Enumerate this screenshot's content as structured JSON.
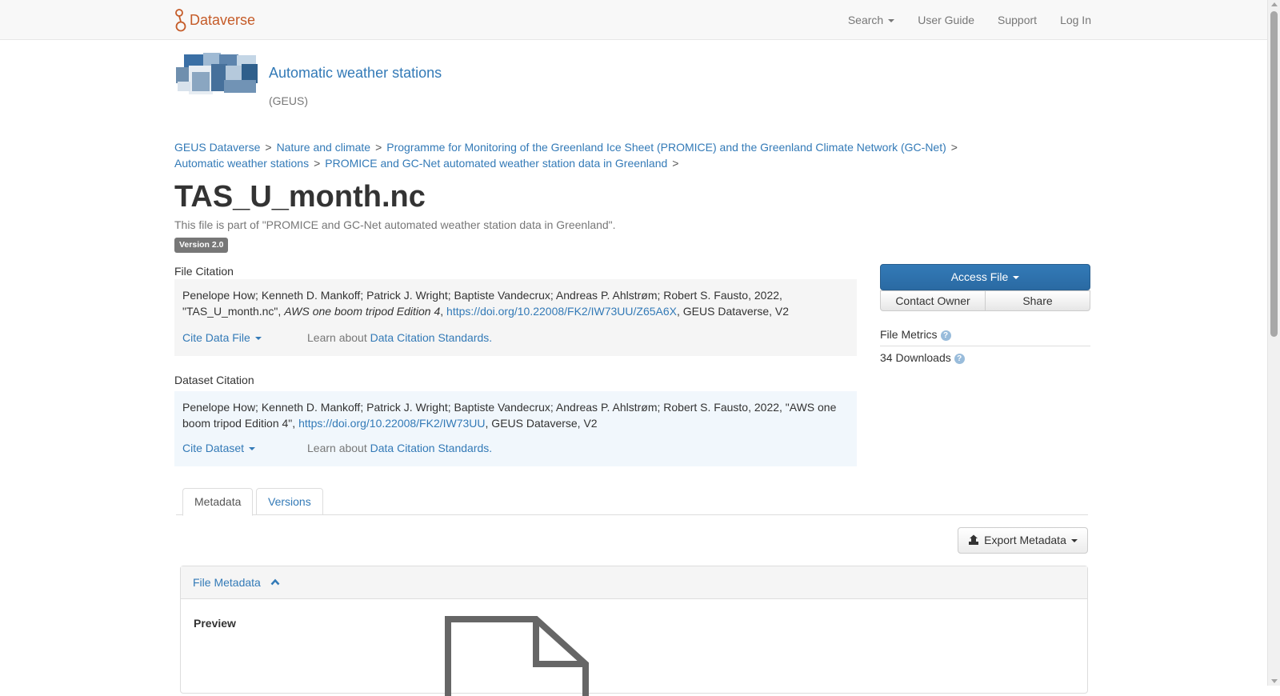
{
  "navbar": {
    "brand": "Dataverse",
    "items": [
      {
        "label": "Search",
        "dropdown": true
      },
      {
        "label": "User Guide"
      },
      {
        "label": "Support"
      },
      {
        "label": "Log In"
      }
    ]
  },
  "dataverse": {
    "name": "Automatic weather stations",
    "affiliation": "(GEUS)"
  },
  "breadcrumbs": [
    "GEUS Dataverse",
    "Nature and climate",
    "Programme for Monitoring of the Greenland Ice Sheet (PROMICE) and the Greenland Climate Network (GC-Net)",
    "Automatic weather stations",
    "PROMICE and GC-Net automated weather station data in Greenland"
  ],
  "breadcrumb_separator": ">",
  "file": {
    "title": "TAS_U_month.nc",
    "part_of": "This file is part of \"PROMICE and GC-Net automated weather station data in Greenland\".",
    "version": "Version 2.0"
  },
  "file_citation": {
    "label": "File Citation",
    "authors": "Penelope How; Kenneth D. Mankoff; Patrick J. Wright; Baptiste Vandecrux; Andreas P. Ahlstrøm; Robert S. Fausto, 2022,",
    "file_name": "\"TAS_U_month.nc\",",
    "dataset_title": "AWS one boom tripod Edition 4",
    "doi": "https://doi.org/10.22008/FK2/IW73UU/Z65A6X",
    "suffix": ", GEUS Dataverse, V2",
    "cite_button": "Cite Data File",
    "learn_prefix": "Learn about",
    "learn_link": "Data Citation Standards."
  },
  "dataset_citation": {
    "label": "Dataset Citation",
    "text": "Penelope How; Kenneth D. Mankoff; Patrick J. Wright; Baptiste Vandecrux; Andreas P. Ahlstrøm; Robert S. Fausto, 2022, \"AWS one boom tripod Edition 4\",",
    "doi": "https://doi.org/10.22008/FK2/IW73UU",
    "suffix": ", GEUS Dataverse, V2",
    "cite_button": "Cite Dataset",
    "learn_prefix": "Learn about",
    "learn_link": "Data Citation Standards."
  },
  "sidebar": {
    "access_file": "Access File",
    "contact_owner": "Contact Owner",
    "share": "Share",
    "file_metrics": "File Metrics",
    "downloads": "34 Downloads"
  },
  "tabs": [
    {
      "label": "Metadata",
      "active": true
    },
    {
      "label": "Versions",
      "active": false
    }
  ],
  "export_metadata": "Export Metadata",
  "file_metadata": {
    "heading": "File Metadata",
    "preview_label": "Preview"
  },
  "colors": {
    "brand": "#c55b28",
    "link": "#337ab7",
    "primary": "#2e6da4",
    "file_citation_bg": "#f5f5f5",
    "dataset_citation_bg": "#f1f7fc"
  },
  "icons": [
    "dataverse-logo-icon",
    "caret-down-icon",
    "question-circle-icon",
    "export-icon",
    "chevron-up-icon",
    "file-icon"
  ]
}
